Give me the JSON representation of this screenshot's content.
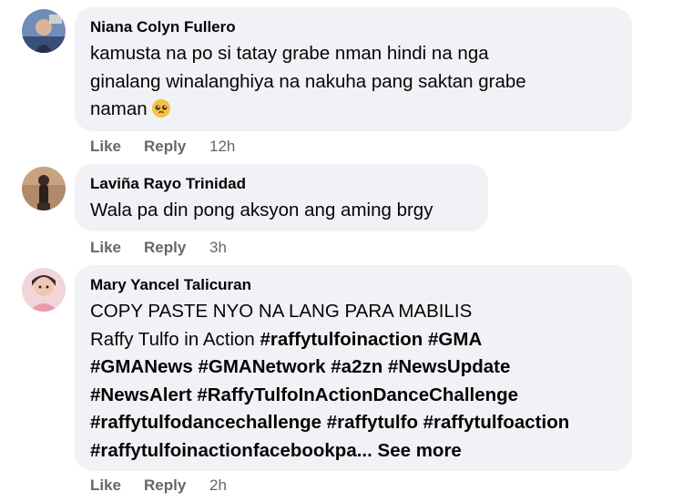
{
  "comments": [
    {
      "author": "Niana Colyn Fullero",
      "lines": [
        "kamusta na po si tatay grabe nman hindi na nga",
        "ginalang winalanghiya na nakuha pang saktan grabe",
        "naman"
      ],
      "emoji": "pleading-face-emoji",
      "like_label": "Like",
      "reply_label": "Reply",
      "time": "12h"
    },
    {
      "author": "Laviña Rayo Trinidad",
      "lines": [
        "Wala pa din pong aksyon ang aming brgy"
      ],
      "like_label": "Like",
      "reply_label": "Reply",
      "time": "3h"
    },
    {
      "author": "Mary Yancel Talicuran",
      "line1": "COPY PASTE NYO NA LANG PARA MABILIS",
      "line2_text": "Raffy Tulfo in Action",
      "line2_tags": "#raffytulfoinaction #GMA",
      "line3": "#GMANews #GMANetwork #a2zn #NewsUpdate",
      "line4": "#NewsAlert #RaffyTulfoInActionDanceChallenge",
      "line5": "#raffytulfodancechallenge #raffytulfo #raffytulfoaction",
      "line6": "#raffytulfoinactionfacebookpa...",
      "see_more": "See more",
      "like_label": "Like",
      "reply_label": "Reply",
      "time": "2h"
    }
  ],
  "colors": {
    "bubble": "#f0f2f5",
    "text": "#050505",
    "meta": "#65676b"
  }
}
